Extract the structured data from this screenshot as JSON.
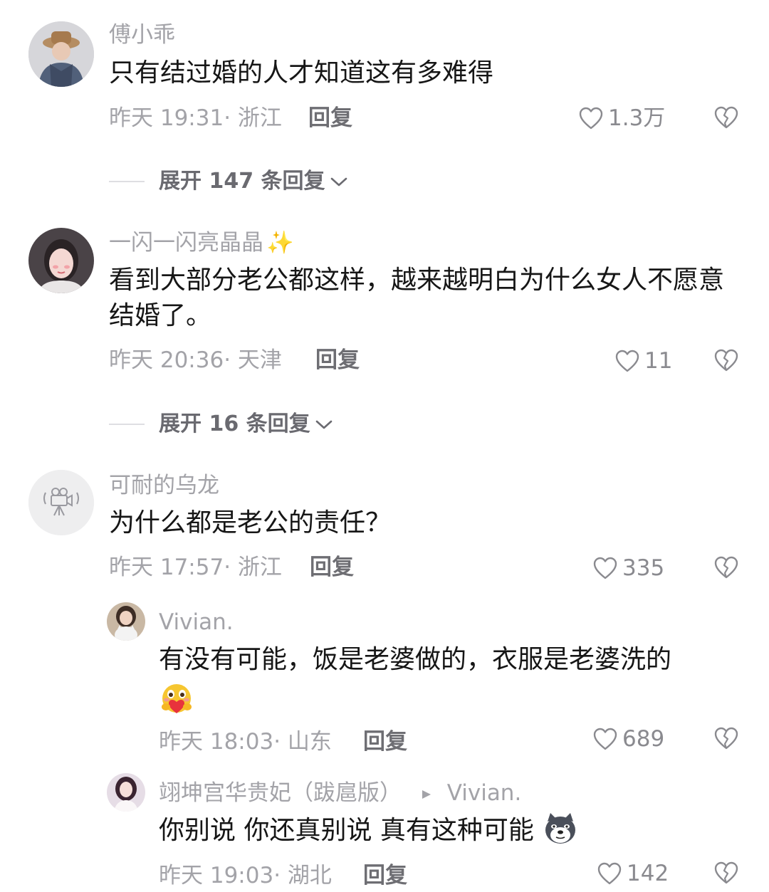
{
  "comments": [
    {
      "user": "傅小乖",
      "text": "只有结过婚的人才知道这有多难得",
      "time": "昨天 19:31· 浙江",
      "reply_label": "回复",
      "likes": "1.3万",
      "expand": "展开 147 条回复"
    },
    {
      "user": "一闪一闪亮晶晶",
      "user_emoji": "✨",
      "text": "看到大部分老公都这样，越来越明白为什么女人不愿意结婚了。",
      "time": "昨天 20:36· 天津",
      "reply_label": "回复",
      "likes": "11",
      "expand": "展开 16 条回复"
    },
    {
      "user": "可耐的乌龙",
      "text": "为什么都是老公的责任？",
      "time": "昨天 17:57· 浙江",
      "reply_label": "回复",
      "likes": "335"
    }
  ],
  "replies": [
    {
      "user": "Vivian.",
      "text": "有没有可能，饭是老婆做的，衣服是老婆洗的",
      "emoji": "hug-emoji",
      "time": "昨天 18:03· 山东",
      "reply_label": "回复",
      "likes": "689"
    },
    {
      "user": "翊坤宫华贵妃（跋扈版）",
      "reply_to": "Vivian.",
      "text": "你别说 你还真别说 真有这种可能",
      "emoji": "doge-emoji",
      "time": "昨天 19:03· 湖北",
      "reply_label": "回复",
      "likes": "142"
    }
  ],
  "icons": {
    "like": "heart-outline-icon",
    "dislike": "broken-heart-icon",
    "expand": "chevron-down-icon",
    "reply_arrow": "triangle-right-icon"
  },
  "colors": {
    "username": "#a3a3a8",
    "text": "#161616",
    "meta": "#a3a3a8",
    "reply": "#6e6e73"
  }
}
